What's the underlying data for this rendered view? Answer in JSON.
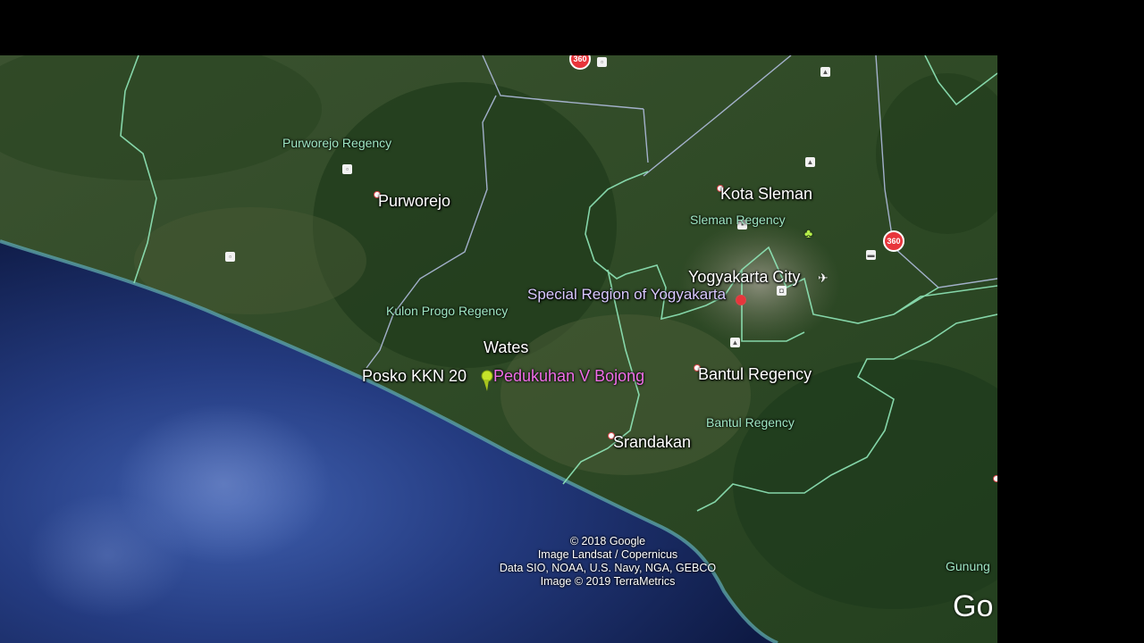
{
  "map": {
    "places": [
      {
        "id": "purworejo",
        "label": "Purworejo"
      },
      {
        "id": "kota-sleman",
        "label": "Kota Sleman"
      },
      {
        "id": "yogyakarta-city",
        "label": "Yogyakarta City"
      },
      {
        "id": "wates",
        "label": "Wates"
      },
      {
        "id": "bantul-regency-city",
        "label": "Bantul Regency"
      },
      {
        "id": "srandakan",
        "label": "Srandakan"
      }
    ],
    "regions": [
      {
        "id": "purworejo-regency",
        "label": "Purworejo Regency"
      },
      {
        "id": "sleman-regency",
        "label": "Sleman Regency"
      },
      {
        "id": "kulon-progo-regency",
        "label": "Kulon Progo Regency"
      },
      {
        "id": "bantul-regency",
        "label": "Bantul Regency"
      },
      {
        "id": "gunung",
        "label": "Gunung"
      }
    ],
    "province_label": "Special Region of Yogyakarta",
    "placemark": {
      "left_label": "Posko KKN 20",
      "right_label": "Pedukuhan V Bojong",
      "color": "#c6e32a"
    },
    "badge_text": "360",
    "logo_text": "Go",
    "attribution": [
      "© 2018 Google",
      "Image Landsat / Copernicus",
      "Data SIO, NOAA, U.S. Navy, NGA, GEBCO",
      "Image © 2019 TerraMetrics"
    ],
    "colors": {
      "land": "#2f4a24",
      "sea": "#1c2f66",
      "boundary": "#8fe6b8",
      "road": "#b7c3e8"
    }
  }
}
